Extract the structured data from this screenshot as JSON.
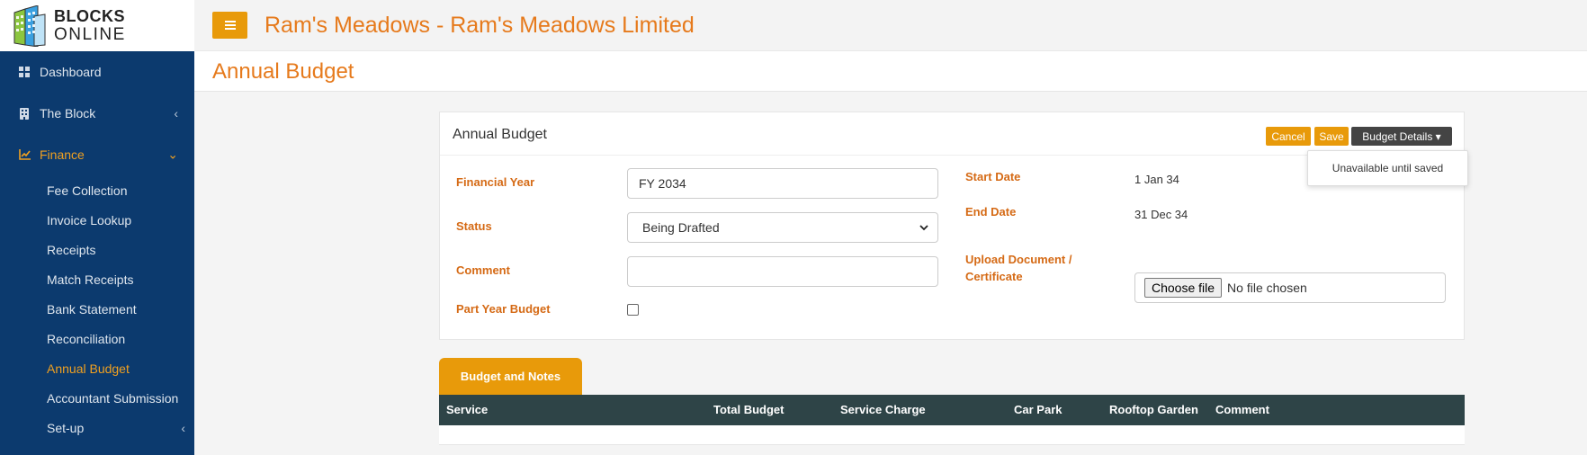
{
  "logo": {
    "line1": "BLOCKS",
    "line2": "ONLINE"
  },
  "sidebar": {
    "items": [
      {
        "label": "Dashboard",
        "icon": "dashboard-grid-icon"
      },
      {
        "label": "The Block",
        "icon": "building-icon",
        "chevron": "‹"
      },
      {
        "label": "Finance",
        "icon": "chart-line-icon",
        "chevron": "⌄"
      }
    ],
    "finance_sub": [
      "Fee Collection",
      "Invoice Lookup",
      "Receipts",
      "Match Receipts",
      "Bank Statement",
      "Reconciliation",
      "Annual Budget",
      "Accountant Submission",
      "Set-up"
    ],
    "setup_chevron": "‹"
  },
  "topbar": {
    "title": "Ram's Meadows - Ram's Meadows Limited"
  },
  "page": {
    "title": "Annual Budget"
  },
  "card": {
    "title": "Annual Budget",
    "buttons": {
      "cancel": "Cancel",
      "save": "Save",
      "details": "Budget Details ▾"
    },
    "dropdown_item": "Unavailable until saved",
    "fields": {
      "financial_year_label": "Financial Year",
      "financial_year_value": "FY 2034",
      "status_label": "Status",
      "status_value": "Being Drafted",
      "comment_label": "Comment",
      "comment_value": "",
      "part_year_label": "Part Year Budget",
      "start_date_label": "Start Date",
      "start_date_value": "1 Jan 34",
      "end_date_label": "End Date",
      "end_date_value": "31 Dec 34",
      "upload_label_1": "Upload Document /",
      "upload_label_2": "Certificate",
      "file_button": "Choose file",
      "file_status": "No file chosen"
    }
  },
  "tabs": [
    "Budget and Notes"
  ],
  "table": {
    "headers": [
      "Service",
      "Total Budget",
      "Service Charge",
      "Car Park",
      "Rooftop Garden",
      "Comment"
    ]
  },
  "colors": {
    "sidebar": "#0c3a6e",
    "accent": "#e89a0a",
    "title": "#e67a1c",
    "table_header": "#2e4447"
  }
}
